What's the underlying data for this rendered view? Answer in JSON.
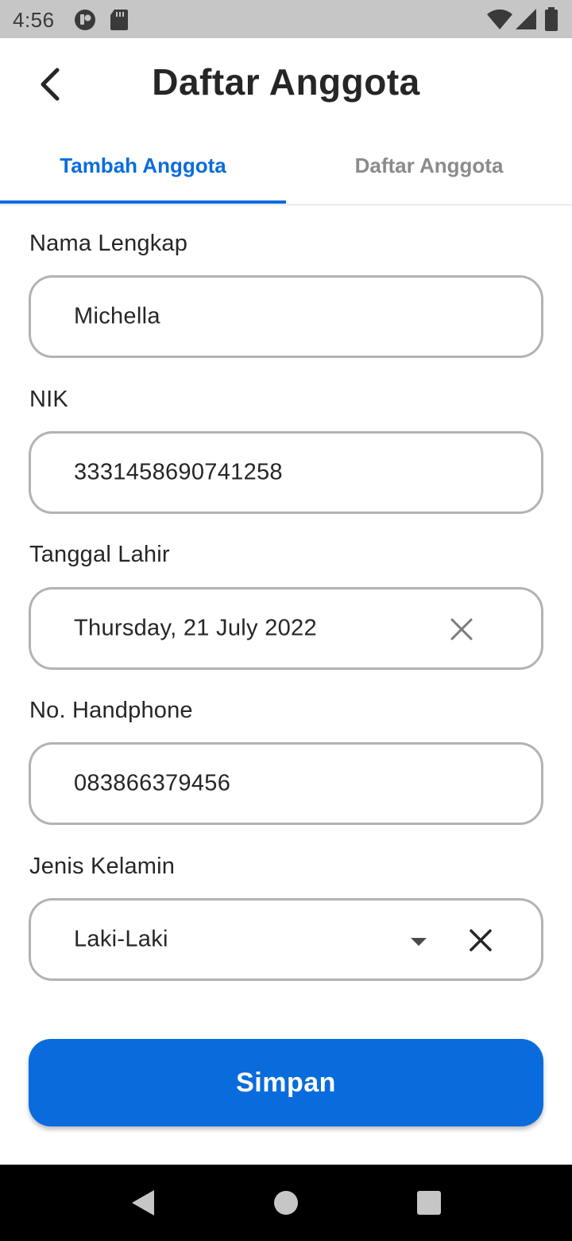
{
  "status_bar": {
    "time": "4:56",
    "icons": [
      "notification-icon",
      "sd-card-icon",
      "wifi-icon",
      "signal-icon",
      "battery-icon"
    ]
  },
  "header": {
    "title": "Daftar Anggota",
    "back_icon": "chevron-left-icon"
  },
  "tabs": [
    {
      "label": "Tambah Anggota",
      "active": true
    },
    {
      "label": "Daftar Anggota",
      "active": false
    }
  ],
  "form": {
    "full_name": {
      "label": "Nama Lengkap",
      "value": "Michella"
    },
    "nik": {
      "label": "NIK",
      "value": "3331458690741258"
    },
    "birth_date": {
      "label": "Tanggal Lahir",
      "value": "Thursday, 21 July 2022",
      "clear_icon": "close-icon"
    },
    "phone": {
      "label": "No. Handphone",
      "value": "083866379456"
    },
    "gender": {
      "label": "Jenis Kelamin",
      "value": "Laki-Laki",
      "dropdown_icon": "dropdown-arrow-icon",
      "clear_icon": "close-icon"
    }
  },
  "save_button": {
    "label": "Simpan"
  },
  "nav_bar": {
    "icons": [
      "back-triangle-icon",
      "home-circle-icon",
      "recents-square-icon"
    ]
  },
  "colors": {
    "accent": "#0a6cdc",
    "status_bar": "#c6c6c6",
    "field_border": "#b3b3b3",
    "inactive_tab": "#8b8b8b",
    "text": "#262626"
  }
}
